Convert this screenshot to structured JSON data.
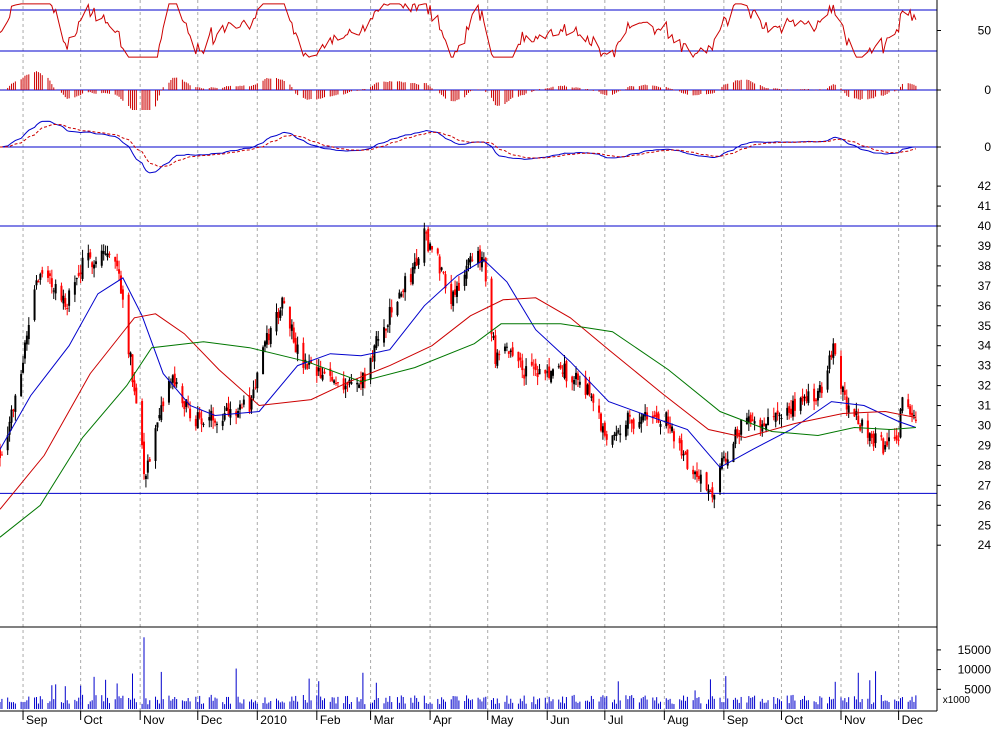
{
  "chart_data": [
    {
      "type": "line",
      "panel": "rsi",
      "y_ticks": [
        {
          "v": 50,
          "label": "50"
        }
      ],
      "ylim": [
        0,
        100
      ],
      "reference_lines": [
        30,
        70
      ],
      "colors": {
        "line": "#cc0000",
        "ref": "#0000cc"
      }
    },
    {
      "type": "bar",
      "panel": "macd-histogram",
      "y_ticks": [
        {
          "v": 0,
          "label": "0"
        }
      ],
      "colors": {
        "bars": "#cc0000",
        "zero": "#0000cc"
      }
    },
    {
      "type": "line",
      "panel": "macd",
      "y_ticks": [
        {
          "v": 0,
          "label": "0"
        }
      ],
      "colors": {
        "macd": "#0000cc",
        "signal": "#cc0000",
        "zero": "#0000cc"
      }
    },
    {
      "type": "candlestick",
      "panel": "price",
      "ylim": [
        23,
        43
      ],
      "y_ticks": [
        {
          "v": 42,
          "label": "42"
        },
        {
          "v": 41,
          "label": "41"
        },
        {
          "v": 40,
          "label": "40"
        },
        {
          "v": 39,
          "label": "39"
        },
        {
          "v": 38,
          "label": "38"
        },
        {
          "v": 37,
          "label": "37"
        },
        {
          "v": 36,
          "label": "36"
        },
        {
          "v": 35,
          "label": "35"
        },
        {
          "v": 34,
          "label": "34"
        },
        {
          "v": 33,
          "label": "33"
        },
        {
          "v": 32,
          "label": "32"
        },
        {
          "v": 31,
          "label": "31"
        },
        {
          "v": 30,
          "label": "30"
        },
        {
          "v": 29,
          "label": "29"
        },
        {
          "v": 28,
          "label": "28"
        },
        {
          "v": 27,
          "label": "27"
        },
        {
          "v": 26,
          "label": "26"
        },
        {
          "v": 25,
          "label": "25"
        },
        {
          "v": 24,
          "label": "24"
        }
      ],
      "support_resistance": [
        40,
        26.6
      ],
      "close_path": [
        {
          "x": "2009-08-20",
          "y": 28.6
        },
        {
          "x": "2009-08-28",
          "y": 31.2
        },
        {
          "x": "2009-09-08",
          "y": 37.5
        },
        {
          "x": "2009-09-16",
          "y": 37.2
        },
        {
          "x": "2009-09-23",
          "y": 36.0
        },
        {
          "x": "2009-10-02",
          "y": 38.0
        },
        {
          "x": "2009-10-13",
          "y": 38.8
        },
        {
          "x": "2009-10-21",
          "y": 37.8
        },
        {
          "x": "2009-10-28",
          "y": 32.5
        },
        {
          "x": "2009-11-01",
          "y": 30.5
        },
        {
          "x": "2009-11-03",
          "y": 27.5
        },
        {
          "x": "2009-11-09",
          "y": 29.5
        },
        {
          "x": "2009-11-17",
          "y": 32.4
        },
        {
          "x": "2009-11-27",
          "y": 30.5
        },
        {
          "x": "2009-12-06",
          "y": 30.2
        },
        {
          "x": "2009-12-18",
          "y": 30.9
        },
        {
          "x": "2009-12-28",
          "y": 31.0
        },
        {
          "x": "2010-01-05",
          "y": 34.0
        },
        {
          "x": "2010-01-15",
          "y": 36.5
        },
        {
          "x": "2010-01-23",
          "y": 33.2
        },
        {
          "x": "2010-02-02",
          "y": 32.5
        },
        {
          "x": "2010-02-14",
          "y": 32.2
        },
        {
          "x": "2010-02-24",
          "y": 32.0
        },
        {
          "x": "2010-03-05",
          "y": 34.3
        },
        {
          "x": "2010-03-16",
          "y": 36.5
        },
        {
          "x": "2010-03-24",
          "y": 38.0
        },
        {
          "x": "2010-03-29",
          "y": 39.5
        },
        {
          "x": "2010-04-05",
          "y": 38.3
        },
        {
          "x": "2010-04-12",
          "y": 36.5
        },
        {
          "x": "2010-04-21",
          "y": 38.0
        },
        {
          "x": "2010-04-29",
          "y": 38.5
        },
        {
          "x": "2010-05-05",
          "y": 33.2
        },
        {
          "x": "2010-05-13",
          "y": 33.8
        },
        {
          "x": "2010-05-20",
          "y": 32.8
        },
        {
          "x": "2010-05-30",
          "y": 32.5
        },
        {
          "x": "2010-06-09",
          "y": 32.8
        },
        {
          "x": "2010-06-22",
          "y": 31.9
        },
        {
          "x": "2010-07-01",
          "y": 29.5
        },
        {
          "x": "2010-07-12",
          "y": 30.2
        },
        {
          "x": "2010-07-23",
          "y": 30.4
        },
        {
          "x": "2010-08-03",
          "y": 30.2
        },
        {
          "x": "2010-08-10",
          "y": 28.5
        },
        {
          "x": "2010-08-18",
          "y": 27.5
        },
        {
          "x": "2010-08-26",
          "y": 26.7
        },
        {
          "x": "2010-09-01",
          "y": 28.2
        },
        {
          "x": "2010-09-08",
          "y": 29.8
        },
        {
          "x": "2010-09-19",
          "y": 30.3
        },
        {
          "x": "2010-09-30",
          "y": 30.5
        },
        {
          "x": "2010-10-10",
          "y": 31.0
        },
        {
          "x": "2010-10-21",
          "y": 31.7
        },
        {
          "x": "2010-10-28",
          "y": 34.2
        },
        {
          "x": "2010-11-02",
          "y": 31.6
        },
        {
          "x": "2010-11-08",
          "y": 30.4
        },
        {
          "x": "2010-11-16",
          "y": 29.5
        },
        {
          "x": "2010-11-23",
          "y": 29.0
        },
        {
          "x": "2010-11-30",
          "y": 29.0
        },
        {
          "x": "2010-12-04",
          "y": 31.8
        },
        {
          "x": "2010-12-10",
          "y": 30.0
        }
      ],
      "moving_averages": [
        {
          "color": "#0000cc",
          "points": [
            {
              "x": "2009-08-20",
              "y": 28.8
            },
            {
              "x": "2009-09-05",
              "y": 31.5
            },
            {
              "x": "2009-09-25",
              "y": 34.0
            },
            {
              "x": "2009-10-10",
              "y": 36.6
            },
            {
              "x": "2009-10-23",
              "y": 37.4
            },
            {
              "x": "2009-11-02",
              "y": 35.5
            },
            {
              "x": "2009-11-13",
              "y": 32.6
            },
            {
              "x": "2009-11-27",
              "y": 31.0
            },
            {
              "x": "2009-12-10",
              "y": 30.5
            },
            {
              "x": "2010-01-02",
              "y": 30.7
            },
            {
              "x": "2010-01-22",
              "y": 33.0
            },
            {
              "x": "2010-02-08",
              "y": 33.6
            },
            {
              "x": "2010-02-24",
              "y": 33.5
            },
            {
              "x": "2010-03-11",
              "y": 33.8
            },
            {
              "x": "2010-03-29",
              "y": 36.0
            },
            {
              "x": "2010-04-15",
              "y": 37.5
            },
            {
              "x": "2010-04-29",
              "y": 38.3
            },
            {
              "x": "2010-05-11",
              "y": 37.2
            },
            {
              "x": "2010-05-26",
              "y": 34.8
            },
            {
              "x": "2010-06-13",
              "y": 33.2
            },
            {
              "x": "2010-07-03",
              "y": 31.2
            },
            {
              "x": "2010-07-23",
              "y": 30.5
            },
            {
              "x": "2010-08-13",
              "y": 29.8
            },
            {
              "x": "2010-08-30",
              "y": 27.9
            },
            {
              "x": "2010-09-16",
              "y": 28.8
            },
            {
              "x": "2010-10-06",
              "y": 29.8
            },
            {
              "x": "2010-10-27",
              "y": 31.2
            },
            {
              "x": "2010-11-13",
              "y": 31.0
            },
            {
              "x": "2010-12-01",
              "y": 30.2
            },
            {
              "x": "2010-12-10",
              "y": 29.9
            }
          ]
        },
        {
          "color": "#cc0000",
          "points": [
            {
              "x": "2009-08-20",
              "y": 25.8
            },
            {
              "x": "2009-09-12",
              "y": 28.5
            },
            {
              "x": "2009-10-06",
              "y": 32.6
            },
            {
              "x": "2009-10-29",
              "y": 35.4
            },
            {
              "x": "2009-11-09",
              "y": 35.6
            },
            {
              "x": "2009-11-24",
              "y": 34.6
            },
            {
              "x": "2009-12-12",
              "y": 32.8
            },
            {
              "x": "2010-01-02",
              "y": 31.0
            },
            {
              "x": "2010-01-29",
              "y": 31.3
            },
            {
              "x": "2010-02-18",
              "y": 32.2
            },
            {
              "x": "2010-03-11",
              "y": 33.0
            },
            {
              "x": "2010-04-02",
              "y": 34.0
            },
            {
              "x": "2010-04-22",
              "y": 35.5
            },
            {
              "x": "2010-05-09",
              "y": 36.3
            },
            {
              "x": "2010-05-26",
              "y": 36.4
            },
            {
              "x": "2010-06-13",
              "y": 35.4
            },
            {
              "x": "2010-07-03",
              "y": 33.8
            },
            {
              "x": "2010-07-31",
              "y": 31.6
            },
            {
              "x": "2010-08-24",
              "y": 29.8
            },
            {
              "x": "2010-09-12",
              "y": 29.4
            },
            {
              "x": "2010-10-08",
              "y": 30.1
            },
            {
              "x": "2010-11-02",
              "y": 30.6
            },
            {
              "x": "2010-11-24",
              "y": 30.7
            },
            {
              "x": "2010-12-10",
              "y": 30.4
            }
          ]
        },
        {
          "color": "#007700",
          "points": [
            {
              "x": "2009-08-20",
              "y": 24.4
            },
            {
              "x": "2009-09-10",
              "y": 26.0
            },
            {
              "x": "2009-10-02",
              "y": 29.4
            },
            {
              "x": "2009-10-25",
              "y": 32.0
            },
            {
              "x": "2009-11-07",
              "y": 33.9
            },
            {
              "x": "2009-12-04",
              "y": 34.2
            },
            {
              "x": "2009-12-28",
              "y": 33.9
            },
            {
              "x": "2010-01-27",
              "y": 33.2
            },
            {
              "x": "2010-02-24",
              "y": 32.2
            },
            {
              "x": "2010-03-24",
              "y": 32.9
            },
            {
              "x": "2010-04-24",
              "y": 34.1
            },
            {
              "x": "2010-05-08",
              "y": 35.1
            },
            {
              "x": "2010-06-08",
              "y": 35.1
            },
            {
              "x": "2010-07-05",
              "y": 34.7
            },
            {
              "x": "2010-08-03",
              "y": 32.8
            },
            {
              "x": "2010-08-30",
              "y": 30.7
            },
            {
              "x": "2010-09-26",
              "y": 29.7
            },
            {
              "x": "2010-10-20",
              "y": 29.5
            },
            {
              "x": "2010-11-08",
              "y": 29.9
            },
            {
              "x": "2010-11-27",
              "y": 29.8
            },
            {
              "x": "2010-12-10",
              "y": 29.9
            }
          ]
        }
      ]
    },
    {
      "type": "bar",
      "panel": "volume",
      "y_ticks": [
        {
          "v": 15000,
          "label": "15000"
        },
        {
          "v": 10000,
          "label": "10000"
        },
        {
          "v": 5000,
          "label": "5000"
        }
      ],
      "unit_label": "x1000",
      "colors": {
        "bars": "#0000cc"
      }
    }
  ],
  "x_axis": {
    "start": "2009-08-20",
    "end": "2010-12-21",
    "months": [
      {
        "label": "Sep",
        "date": "2009-09-01"
      },
      {
        "label": "Oct",
        "date": "2009-10-01"
      },
      {
        "label": "Nov",
        "date": "2009-11-01"
      },
      {
        "label": "Dec",
        "date": "2009-12-01"
      },
      {
        "label": "2010",
        "date": "2010-01-01"
      },
      {
        "label": "Feb",
        "date": "2010-02-01"
      },
      {
        "label": "Mar",
        "date": "2010-03-01"
      },
      {
        "label": "Apr",
        "date": "2010-04-01"
      },
      {
        "label": "May",
        "date": "2010-05-01"
      },
      {
        "label": "Jun",
        "date": "2010-06-01"
      },
      {
        "label": "Jul",
        "date": "2010-07-01"
      },
      {
        "label": "Aug",
        "date": "2010-08-01"
      },
      {
        "label": "Sep",
        "date": "2010-09-01"
      },
      {
        "label": "Oct",
        "date": "2010-10-01"
      },
      {
        "label": "Nov",
        "date": "2010-11-01"
      },
      {
        "label": "Dec",
        "date": "2010-12-01"
      }
    ]
  },
  "colors": {
    "frame": "#000000",
    "grid": "#aaaaaa",
    "up": "#000000",
    "down": "#ff0000"
  }
}
